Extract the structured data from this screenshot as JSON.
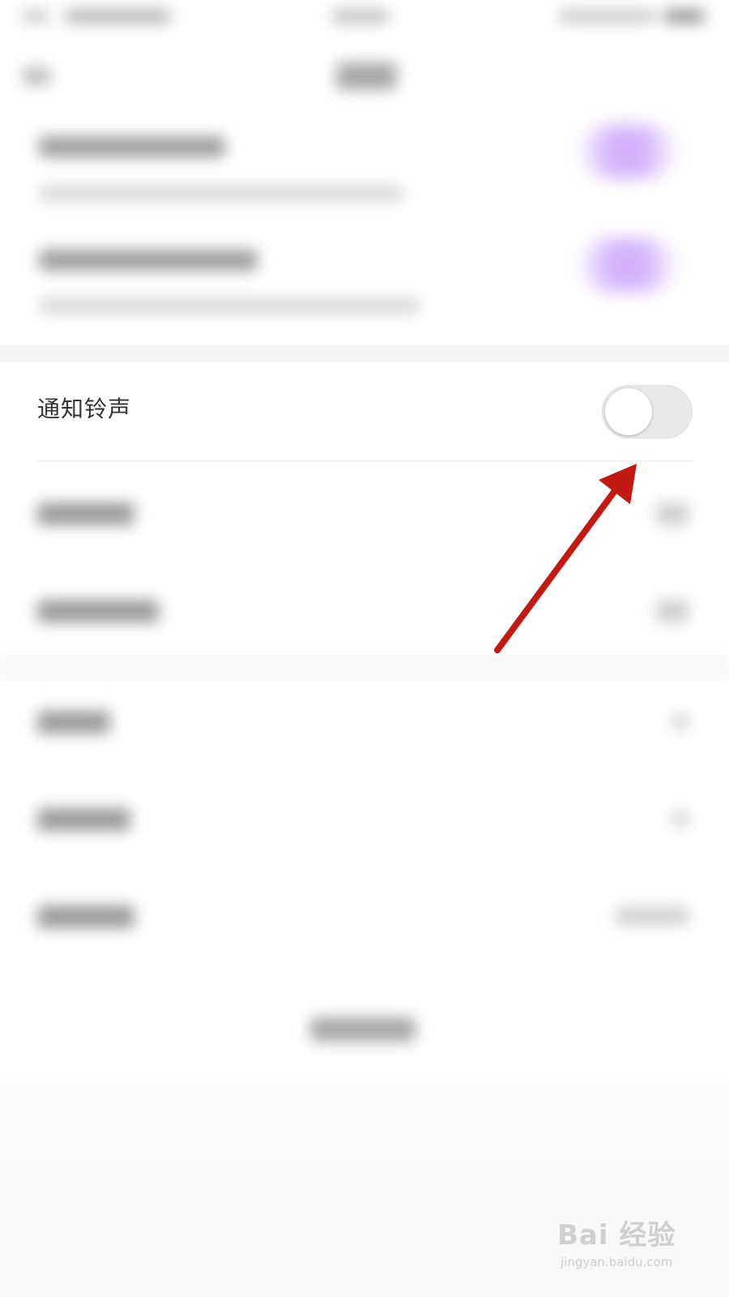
{
  "settings": {
    "notification_ringtone": {
      "label": "通知铃声",
      "enabled": false
    }
  },
  "annotation": {
    "arrow_color": "#c21a12"
  },
  "watermark": {
    "brand": "Bai  经验",
    "url": "jingyan.baidu.com"
  },
  "colors": {
    "accent_purple": "#cfa6fb",
    "toggle_off_track": "#e8e8e8"
  }
}
